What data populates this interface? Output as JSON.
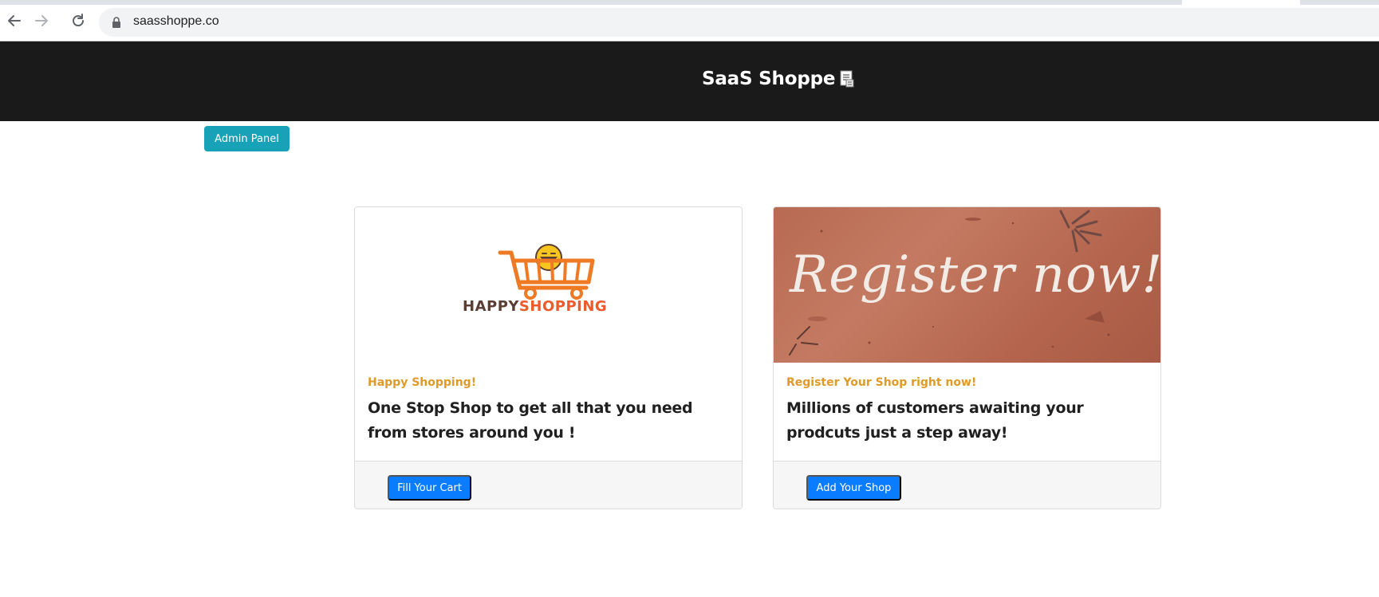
{
  "browser": {
    "url": "saasshoppe.co"
  },
  "header": {
    "title": "SaaS Shoppe"
  },
  "admin_button": "Admin Panel",
  "cards": [
    {
      "logo_word_1": "HAPPY",
      "logo_word_2": "SHOPPING",
      "subtitle": "Happy Shopping!",
      "text": "One Stop Shop to get all that you need from stores around you !",
      "button": "Fill Your Cart"
    },
    {
      "image_text": "Register now!",
      "subtitle": "Register Your Shop right now!",
      "text": "Millions of customers awaiting your prodcuts just a step away!",
      "button": "Add Your Shop"
    }
  ],
  "colors": {
    "header_bg": "#1b1a1a",
    "admin_button": "#17a2b8",
    "primary_button": "#0a7cff",
    "subtitle": "#e09a27",
    "logo_orange": "#ef5a2a"
  }
}
